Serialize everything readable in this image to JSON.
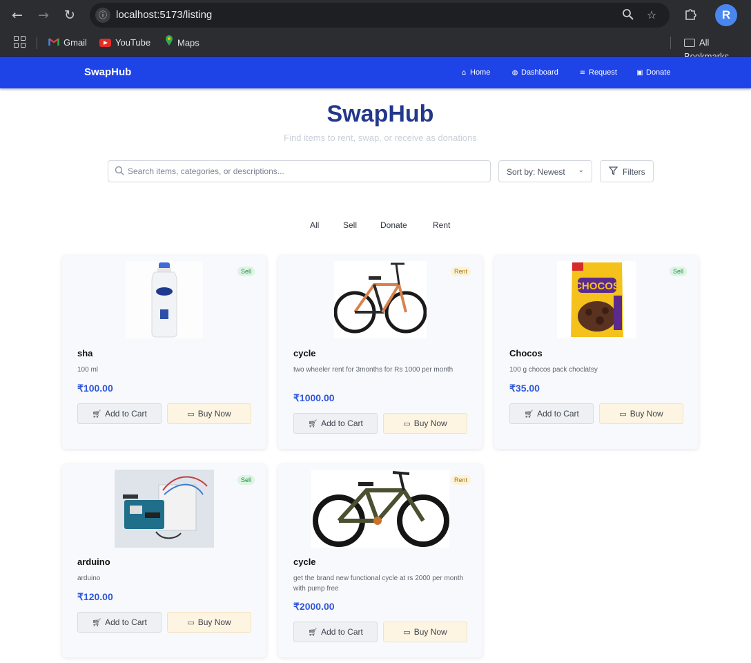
{
  "browser": {
    "url": "localhost:5173/listing",
    "profile_initial": "R",
    "bookmarks": [
      {
        "label": "Gmail",
        "icon": "gmail-icon"
      },
      {
        "label": "YouTube",
        "icon": "youtube-icon"
      },
      {
        "label": "Maps",
        "icon": "maps-icon"
      }
    ],
    "all_bookmarks_label": "All Bookmarks"
  },
  "navbar": {
    "brand": "SwapHub",
    "links": [
      {
        "label": "Home",
        "icon": "home-icon"
      },
      {
        "label": "Dashboard",
        "icon": "dashboard-icon"
      },
      {
        "label": "Request",
        "icon": "list-icon"
      },
      {
        "label": "Donate",
        "icon": "gift-icon"
      }
    ],
    "color": "#1e44e8"
  },
  "hero": {
    "title": "SwapHub",
    "subtitle": "Find items to rent, swap, or receive as donations"
  },
  "search": {
    "placeholder": "Search items, categories, or descriptions...",
    "value": ""
  },
  "sort": {
    "selected": "Sort by: Newest"
  },
  "filters_label": "Filters",
  "tabs": [
    "All",
    "Sell",
    "Donate",
    "Rent"
  ],
  "buttons": {
    "add_to_cart": "Add to Cart",
    "buy_now": "Buy Now"
  },
  "products": [
    {
      "title": "sha",
      "desc": "100 ml",
      "price": "₹100.00",
      "badge": "Sell",
      "image": "shampoo-bottle-image"
    },
    {
      "title": "cycle",
      "desc": "two wheeler rent for 3months for Rs 1000 per month",
      "price": "₹1000.00",
      "badge": "Rent",
      "image": "bicycle-image"
    },
    {
      "title": "Chocos",
      "desc": "100 g chocos pack choclatsy",
      "price": "₹35.00",
      "badge": "Sell",
      "image": "chocos-pack-image"
    },
    {
      "title": "arduino",
      "desc": "arduino",
      "price": "₹120.00",
      "badge": "Sell",
      "image": "arduino-board-image"
    },
    {
      "title": "cycle",
      "desc": "get the brand new functional cycle at rs 2000 per month with pump free",
      "price": "₹2000.00",
      "badge": "Rent",
      "image": "mountain-bike-image"
    }
  ],
  "colors": {
    "accent": "#2f56d9",
    "title": "#23378c",
    "sell_badge": "#dbf5e2",
    "rent_badge": "#fdf2d6"
  }
}
